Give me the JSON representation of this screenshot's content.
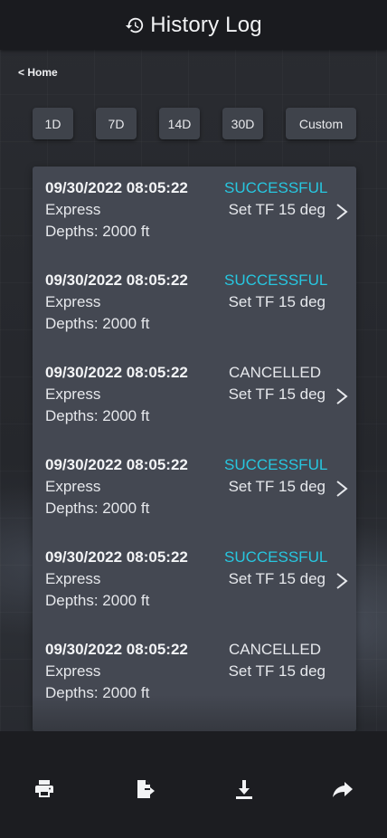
{
  "header": {
    "title": "History Log",
    "icon": "history-icon"
  },
  "nav": {
    "back_label": "< Home"
  },
  "ranges": [
    "1D",
    "7D",
    "14D",
    "30D",
    "Custom"
  ],
  "entries": [
    {
      "date": "09/30/2022 08:05:22",
      "status": "SUCCESSFUL",
      "type": "Express",
      "action": "Set TF 15 deg",
      "depth": "Depths: 2000 ft",
      "has_chevron": true
    },
    {
      "date": "09/30/2022 08:05:22",
      "status": "SUCCESSFUL",
      "type": "Express",
      "action": "Set TF 15 deg",
      "depth": "Depths: 2000 ft",
      "has_chevron": false
    },
    {
      "date": "09/30/2022 08:05:22",
      "status": "CANCELLED",
      "type": "Express",
      "action": "Set TF 15 deg",
      "depth": "Depths: 2000 ft",
      "has_chevron": true
    },
    {
      "date": "09/30/2022 08:05:22",
      "status": "SUCCESSFUL",
      "type": "Express",
      "action": "Set TF 15 deg",
      "depth": "Depths: 2000 ft",
      "has_chevron": true
    },
    {
      "date": "09/30/2022 08:05:22",
      "status": "SUCCESSFUL",
      "type": "Express",
      "action": "Set TF 15 deg",
      "depth": "Depths: 2000 ft",
      "has_chevron": true
    },
    {
      "date": "09/30/2022 08:05:22",
      "status": "CANCELLED",
      "type": "Express",
      "action": "Set TF 15 deg",
      "depth": "Depths: 2000 ft",
      "has_chevron": false
    }
  ],
  "colors": {
    "success": "#27c7e0",
    "cancelled": "#e6e8ec",
    "card": "#444852"
  },
  "footer": {
    "icons": [
      "print-icon",
      "export-icon",
      "download-icon",
      "share-icon"
    ]
  }
}
